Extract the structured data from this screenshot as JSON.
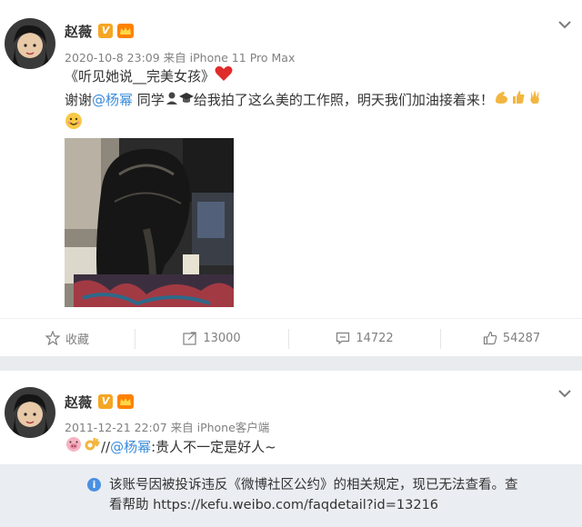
{
  "post1": {
    "user_name": "赵薇",
    "v_badge": "V",
    "timestamp": "2020-10-8 23:09",
    "source": "来自 iPhone 11 Pro Max",
    "line1_text": "《听见她说__完美女孩》",
    "line2_prefix": "谢谢",
    "mention": "@杨幂",
    "line2_mid": " 同学",
    "line2_suffix": "给我拍了这么美的工作照，明天我们加油接着来！",
    "actions": {
      "favorite_label": "收藏",
      "repost_count": "13000",
      "comment_count": "14722",
      "like_count": "54287"
    }
  },
  "post2": {
    "user_name": "赵薇",
    "v_badge": "V",
    "timestamp": "2011-12-21 22:07",
    "source": "来自 iPhone客户端",
    "text_prefix": "//",
    "mention": "@杨幂",
    "text_suffix": ":贵人不一定是好人~",
    "notice_line1": "该账号因被投诉违反《微博社区公约》的相关规定，现已无法查看。查",
    "notice_line2": "看帮助 https://kefu.weibo.com/faqdetail?id=13216"
  },
  "colors": {
    "mention_orange": "#eb7350",
    "mention_blue": "#3b8cd9",
    "badge": "#f5a623",
    "meta_gray": "#808080",
    "notice_bg": "#eaedf2"
  }
}
